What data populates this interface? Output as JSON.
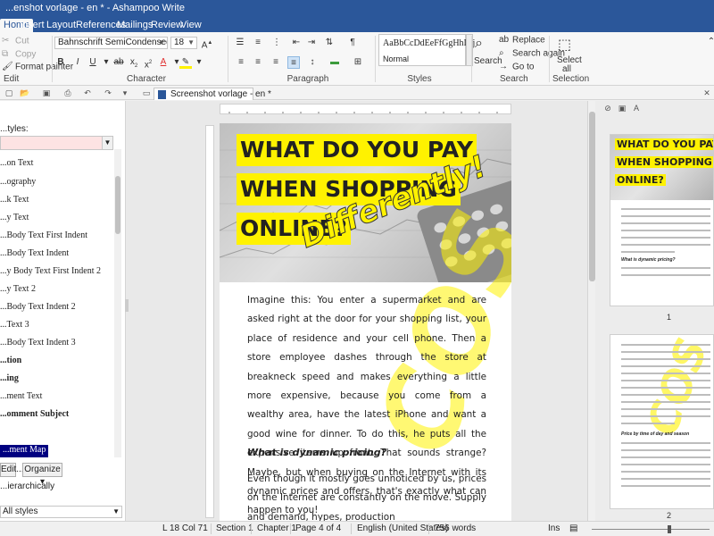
{
  "window": {
    "title": "...enshot vorlage - en * - Ashampoo Write"
  },
  "menu": {
    "tabs": [
      "Home",
      "Insert",
      "Layout",
      "References",
      "Mailings",
      "Review",
      "View"
    ]
  },
  "ribbon": {
    "edit": {
      "cut": "Cut",
      "copy": "Copy",
      "format_painter": "Format painter",
      "label": "Edit"
    },
    "character": {
      "font": "Bahnschrift SemiCondensed",
      "size": "18",
      "label": "Character",
      "text_color": "#e03030",
      "highlight": "#fff200"
    },
    "paragraph": {
      "label": "Paragraph"
    },
    "styles": {
      "preview": "AaBbCcDdEeFfGgHhIiJj",
      "name": "Normal",
      "label": "Styles"
    },
    "search": {
      "search": "Search",
      "replace": "Replace",
      "search_again": "Search again",
      "goto": "Go to",
      "label": "Search"
    },
    "selection": {
      "select_all": "Select all",
      "label": "Selection"
    }
  },
  "document_tab": "Screenshot vorlage - en *",
  "styles_panel": {
    "label": "...tyles:",
    "items": [
      {
        "text": "...on Text",
        "bold": false
      },
      {
        "text": "...ography",
        "bold": false
      },
      {
        "text": "...k Text",
        "bold": false
      },
      {
        "text": "...y Text",
        "bold": false
      },
      {
        "text": "...Body Text First Indent",
        "bold": false
      },
      {
        "text": "...Body Text Indent",
        "bold": false
      },
      {
        "text": "...y Body Text First Indent 2",
        "bold": false
      },
      {
        "text": "...y Text 2",
        "bold": false
      },
      {
        "text": "...Body Text Indent 2",
        "bold": false
      },
      {
        "text": "...Text 3",
        "bold": false
      },
      {
        "text": "...Body Text Indent 3",
        "bold": false
      },
      {
        "text": "...tion",
        "bold": true
      },
      {
        "text": "...ing",
        "bold": true
      },
      {
        "text": "...ment Text",
        "bold": false
      },
      {
        "text": "...omment Subject",
        "bold": true
      },
      {
        "text": "",
        "bold": false
      },
      {
        "text": "...ment Map",
        "bold": false,
        "selected": true
      }
    ],
    "edit_button": "Edit...",
    "organize_button": "Organize",
    "hierarchically": "...ierarchically",
    "filter": "All styles"
  },
  "page": {
    "headline": [
      "WHAT DO YOU PAY",
      "WHEN SHOPPING",
      "ONLINE?"
    ],
    "differently": "Differently!",
    "paragraph1": "Imagine this: You enter a supermarket and are asked right at the door for your shopping list, your place of residence and your cell phone. Then a store employee dashes through the store at breakneck speed and makes everything a little more expensive, because you come from a wealthy area, have the latest iPhone and want a good wine for dinner. To do this, he puts all the expensive items up front. That sounds strange? Maybe, but when buying on the Internet with its dynamic prices and offers, that's exactly what can happen to you!",
    "subheading": "What is dynamic pricing?",
    "paragraph2": "Even though it mostly goes unnoticed by us, prices on the Internet are constantly on the move. Supply and demand, hypes, production",
    "watermark": "COS"
  },
  "thumbnails": [
    {
      "number": "1",
      "headline": [
        "WHAT DO YOU PAY",
        "WHEN SHOPPING",
        "ONLINE?"
      ],
      "subheading": "What is dynamic pricing?"
    },
    {
      "number": "2",
      "subheading": "Price by time of day and season"
    }
  ],
  "statusbar": {
    "line_col": "L 18 Col 71",
    "section": "Section 1",
    "chapter": "Chapter 1",
    "page": "Page 4 of 4",
    "language": "English (United States)",
    "words": "756 words",
    "ins": "Ins"
  }
}
